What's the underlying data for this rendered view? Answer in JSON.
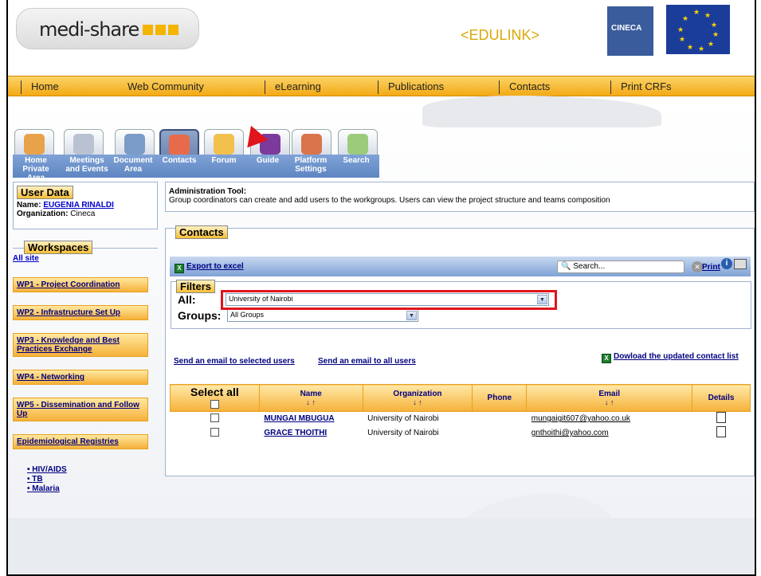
{
  "brand": {
    "logo_text": "medi-share",
    "edulink": "EDULINK",
    "cineca": "CINECA"
  },
  "topnav": [
    "Home",
    "Web Community",
    "eLearning",
    "Publications",
    "Contacts",
    "Print CRFs"
  ],
  "toolbar": [
    {
      "label": "Home\nPrivate Area",
      "icon": "home-icon"
    },
    {
      "label": "Meetings\nand Events",
      "icon": "meetings-icon"
    },
    {
      "label": "Document\nArea",
      "icon": "document-icon"
    },
    {
      "label": "Contacts",
      "icon": "contacts-icon"
    },
    {
      "label": "Forum",
      "icon": "forum-icon"
    },
    {
      "label": "Guide",
      "icon": "guide-icon"
    },
    {
      "label": "Platform\nSettings",
      "icon": "settings-icon"
    },
    {
      "label": "Search",
      "icon": "search-icon"
    }
  ],
  "user": {
    "legend": "User Data",
    "name_label": "Name:",
    "name": "EUGENIA RINALDI",
    "org_label": "Organization:",
    "org": "Cineca"
  },
  "workspaces": {
    "legend": "Workspaces",
    "all": "All site",
    "items": [
      "WP1 - Project Coordination",
      "WP2 - Infrastructure Set Up",
      "WP3 - Knowledge and Best Practices Exchange",
      "WP4 - Networking",
      "WP5 - Dissemination and Follow Up",
      "Epidemiological Registries"
    ],
    "bullets": [
      "HIV/AIDS",
      "TB",
      "Malaria"
    ]
  },
  "admin": {
    "title": "Administration Tool:",
    "desc": "Group coordinators can create and add users to the workgroups. Users can view the project structure and teams composition"
  },
  "contacts": {
    "legend": "Contacts",
    "export": "Export to excel",
    "search_placeholder": "Search...",
    "print": "Print"
  },
  "filters": {
    "legend": "Filters",
    "all_label": "All:",
    "all_value": "University of Nairobi",
    "groups_label": "Groups:",
    "groups_value": "All Groups"
  },
  "links": {
    "email_selected": "Send an email to selected users",
    "email_all": "Send an email to all users",
    "download": "Dowload the updated contact list"
  },
  "table": {
    "select_all": "Select all",
    "headers": [
      "Name",
      "Organization",
      "Phone",
      "Email",
      "Details"
    ],
    "sort": "↓ ↑",
    "rows": [
      {
        "name": "MUNGAI MBUGUA",
        "org": "University of Nairobi",
        "phone": "",
        "email": "mungaigit607@yahoo.co.uk"
      },
      {
        "name": "GRACE THOITHI",
        "org": "University of Nairobi",
        "phone": "",
        "email": "gnthoithi@yahoo.com"
      }
    ]
  }
}
